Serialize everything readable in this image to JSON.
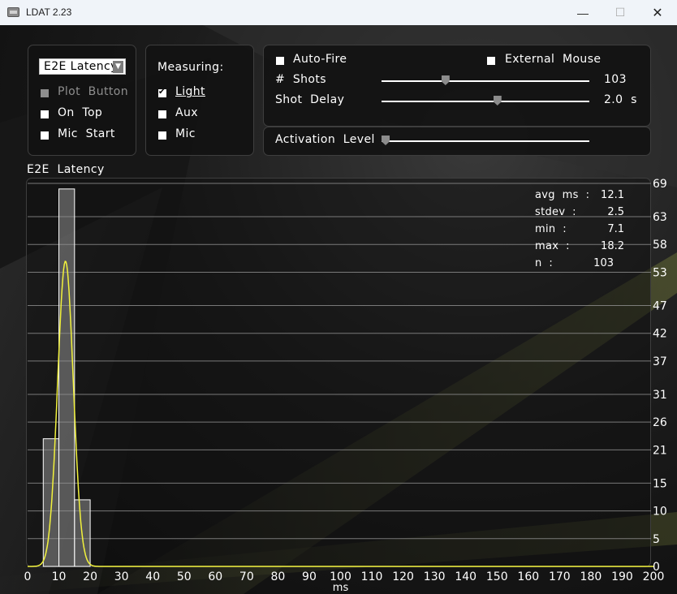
{
  "window": {
    "title": "LDAT 2.23",
    "minimize_glyph": "—",
    "maximize_glyph": "☐",
    "close_glyph": "✕"
  },
  "mode_panel": {
    "selected_mode": "E2E  Latency",
    "options": [
      {
        "label": "Plot  Button",
        "checked": false,
        "enabled": false
      },
      {
        "label": "On  Top",
        "checked": false,
        "enabled": true
      },
      {
        "label": "Mic  Start",
        "checked": false,
        "enabled": true
      }
    ]
  },
  "measuring_panel": {
    "title": "Measuring:",
    "options": [
      {
        "label": "Light",
        "checked": true
      },
      {
        "label": "Aux",
        "checked": false
      },
      {
        "label": "Mic",
        "checked": false
      }
    ]
  },
  "fire_panel": {
    "auto_fire_label": "Auto-Fire",
    "auto_fire_checked": false,
    "external_mouse_label": "External  Mouse",
    "external_mouse_checked": false,
    "shots_label": "#  Shots",
    "shots_value": "103",
    "shots_fraction": 0.3,
    "shot_delay_label": "Shot  Delay",
    "shot_delay_value": "2.0  s",
    "shot_delay_fraction": 0.56
  },
  "activation_panel": {
    "label": "Activation  Level",
    "fraction": 0.0
  },
  "stats": [
    {
      "label": "avg  ms  :",
      "value": "12.1"
    },
    {
      "label": "stdev  :",
      "value": "2.5"
    },
    {
      "label": "min  :",
      "value": "7.1"
    },
    {
      "label": "max  :",
      "value": "18.2"
    },
    {
      "label": "n  :",
      "value": "103"
    }
  ],
  "chart_data": {
    "type": "bar",
    "title": "E2E  Latency",
    "xlabel": "ms",
    "ylabel": "",
    "xlim": [
      0,
      200
    ],
    "ylim": [
      0,
      69
    ],
    "x_ticks": [
      0,
      10,
      20,
      30,
      40,
      50,
      60,
      70,
      80,
      90,
      100,
      110,
      120,
      130,
      140,
      150,
      160,
      170,
      180,
      190,
      200
    ],
    "y_ticks": [
      0,
      5,
      10,
      15,
      21,
      26,
      31,
      37,
      42,
      47,
      53,
      58,
      63,
      69
    ],
    "bin_width": 5,
    "bins": [
      {
        "x0": 5,
        "x1": 10,
        "count": 23
      },
      {
        "x0": 10,
        "x1": 15,
        "count": 68
      },
      {
        "x0": 15,
        "x1": 20,
        "count": 12
      }
    ],
    "fit_curve": {
      "type": "normal",
      "mean": 12.1,
      "stdev": 2.5,
      "peak": 55
    },
    "grid": true,
    "bar_color": "#8f8f8f",
    "curve_color": "#f2f23c"
  },
  "colors": {
    "accent_green": "#9aa33a",
    "curve": "#f2f23c"
  }
}
